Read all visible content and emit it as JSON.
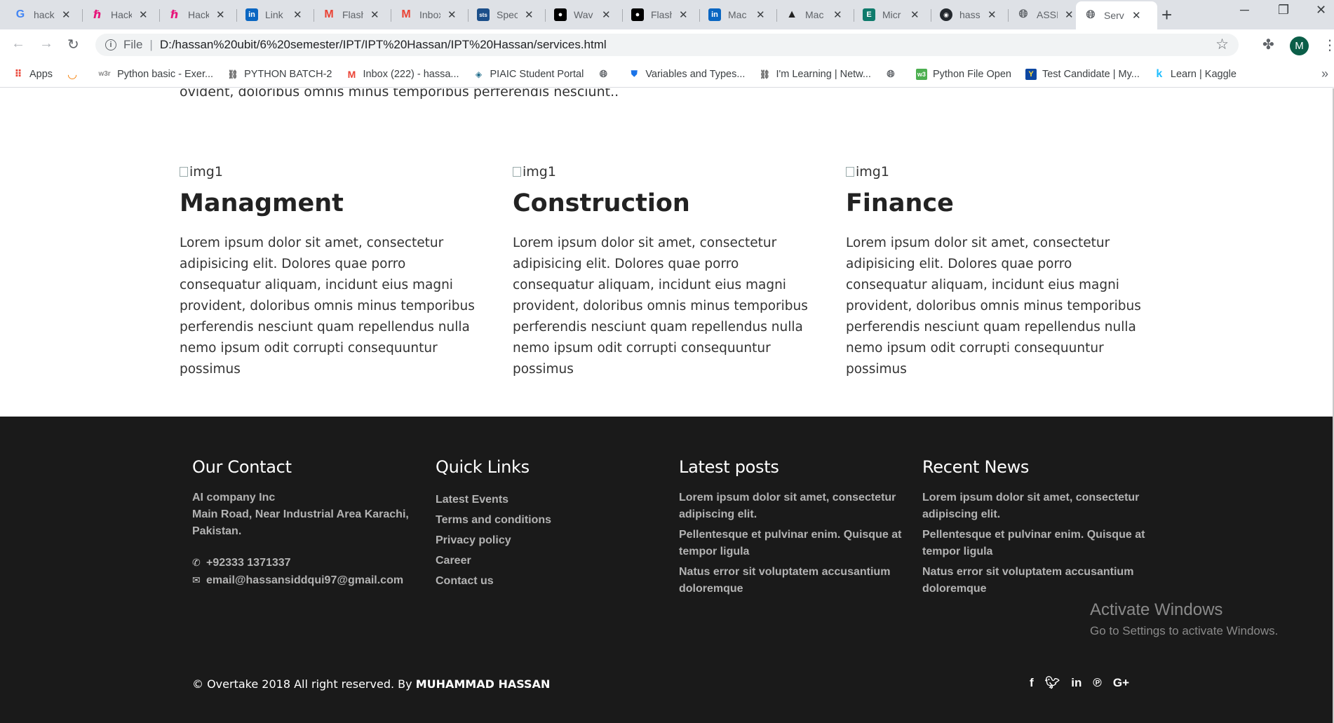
{
  "browser": {
    "tabs": [
      {
        "title": "hack",
        "favicon": "G",
        "fav_color": "#4285f4"
      },
      {
        "title": "Hack",
        "favicon": "H",
        "fav_color": "#e7157b"
      },
      {
        "title": "Hack",
        "favicon": "H",
        "fav_color": "#e7157b"
      },
      {
        "title": "Link",
        "favicon": "in",
        "fav_color": "#0a66c2"
      },
      {
        "title": "Flash",
        "favicon": "M",
        "fav_color": "#ea4335"
      },
      {
        "title": "Inbox",
        "favicon": "M",
        "fav_color": "#ea4335"
      },
      {
        "title": "Spec",
        "favicon": "sts",
        "fav_color": "#1b4f8a"
      },
      {
        "title": "Wav",
        "favicon": "M",
        "fav_color": "#000000"
      },
      {
        "title": "Flash",
        "favicon": "M",
        "fav_color": "#000000"
      },
      {
        "title": "Mac",
        "favicon": "in",
        "fav_color": "#0a66c2"
      },
      {
        "title": "Mac",
        "favicon": "A",
        "fav_color": "#222222"
      },
      {
        "title": "Micr",
        "favicon": "E",
        "fav_color": "#0f7b6c"
      },
      {
        "title": "hass",
        "favicon": "gh",
        "fav_color": "#24292e"
      },
      {
        "title": "ASSI",
        "favicon": "globe",
        "fav_color": "#5f6368"
      },
      {
        "title": "Serv",
        "favicon": "globe",
        "fav_color": "#5f6368"
      }
    ],
    "address": {
      "protocol": "File",
      "url": "D:/hassan%20ubit/6%20semester/IPT/IPT%20Hassan/IPT%20Hassan/services.html"
    },
    "profile_initial": "M",
    "bookmarks": [
      {
        "label": "Apps",
        "icon": "apps-grid"
      },
      {
        "label": "",
        "icon": "loader"
      },
      {
        "label": "Python basic - Exer...",
        "icon": "w3r"
      },
      {
        "label": "PYTHON BATCH-2",
        "icon": "group"
      },
      {
        "label": "Inbox (222) - hassa...",
        "icon": "gmail"
      },
      {
        "label": "PIAIC Student Portal",
        "icon": "piaic"
      },
      {
        "label": "",
        "icon": "globe"
      },
      {
        "label": "Variables and Types...",
        "icon": "shield"
      },
      {
        "label": "I'm Learning | Netw...",
        "icon": "group"
      },
      {
        "label": "",
        "icon": "globe"
      },
      {
        "label": "Python File Open",
        "icon": "w3"
      },
      {
        "label": "Test Candidate | My...",
        "icon": "candidate"
      },
      {
        "label": "Learn | Kaggle",
        "icon": "kaggle"
      }
    ]
  },
  "page": {
    "intro_tail": "ovident, doloribus omnis minus temporibus perferendis nesciunt..",
    "services": [
      {
        "img_alt": "img1",
        "title": "Managment",
        "text": "Lorem ipsum dolor sit amet, consectetur adipisicing elit. Dolores quae porro consequatur aliquam, incidunt eius magni provident, doloribus omnis minus temporibus perferendis nesciunt quam repellendus nulla nemo ipsum odit corrupti consequuntur possimus"
      },
      {
        "img_alt": "img1",
        "title": "Construction",
        "text": "Lorem ipsum dolor sit amet, consectetur adipisicing elit. Dolores quae porro consequatur aliquam, incidunt eius magni provident, doloribus omnis minus temporibus perferendis nesciunt quam repellendus nulla nemo ipsum odit corrupti consequuntur possimus"
      },
      {
        "img_alt": "img1",
        "title": "Finance",
        "text": "Lorem ipsum dolor sit amet, consectetur adipisicing elit. Dolores quae porro consequatur aliquam, incidunt eius magni provident, doloribus omnis minus temporibus perferendis nesciunt quam repellendus nulla nemo ipsum odit corrupti consequuntur possimus"
      }
    ],
    "footer": {
      "contact": {
        "heading": "Our Contact",
        "company": "AI company Inc",
        "address": "Main Road, Near Industrial Area Karachi, Pakistan.",
        "phone": "+92333 1371337",
        "email": "email@hassansiddqui97@gmail.com"
      },
      "quick_links": {
        "heading": "Quick Links",
        "links": [
          "Latest Events",
          "Terms and conditions",
          "Privacy policy",
          "Career",
          "Contact us"
        ]
      },
      "latest_posts": {
        "heading": "Latest posts",
        "posts": [
          "Lorem ipsum dolor sit amet, consectetur adipiscing elit.",
          "Pellentesque et pulvinar enim. Quisque at tempor ligula",
          "Natus error sit voluptatem accusantium doloremque"
        ]
      },
      "recent_news": {
        "heading": "Recent News",
        "posts": [
          "Lorem ipsum dolor sit amet, consectetur adipiscing elit.",
          "Pellentesque et pulvinar enim. Quisque at tempor ligula",
          "Natus error sit voluptatem accusantium doloremque"
        ]
      },
      "copyright_prefix": "© Overtake 2018 All right reserved. By",
      "copyright_author": "MUHAMMAD HASSAN",
      "social_icons": [
        "facebook-icon",
        "twitter-icon",
        "linkedin-icon",
        "pinterest-icon",
        "google-plus-icon"
      ]
    }
  },
  "os_overlay": {
    "title": "Activate Windows",
    "subtitle": "Go to Settings to activate Windows."
  }
}
